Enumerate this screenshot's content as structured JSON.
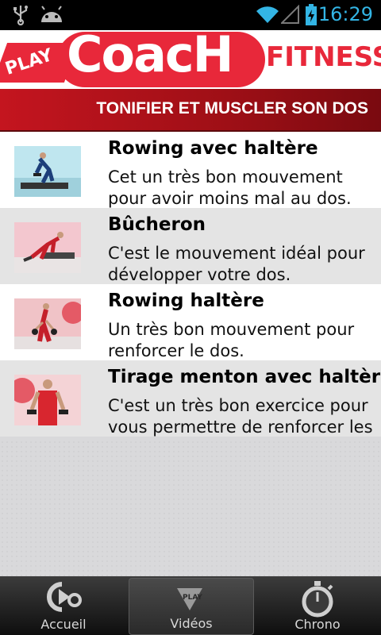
{
  "status_bar": {
    "time": "16:29",
    "icons": [
      "usb-icon",
      "android-icon",
      "wifi-icon",
      "signal-icon",
      "battery-charging-icon"
    ],
    "accent_color": "#33b5e5"
  },
  "header": {
    "logo_play": "PLAY",
    "logo_coach": "CoacH",
    "logo_fitness": "FITNESS",
    "brand_color": "#e8283a"
  },
  "title_bar": {
    "title": "TONIFIER ET MUSCLER SON DOS"
  },
  "videos": [
    {
      "title": "Rowing avec haltère",
      "description_line1": "Cet un très bon mouvement",
      "description_line2": "pour avoir moins mal au dos."
    },
    {
      "title": "Bûcheron",
      "description_line1": "C'est le mouvement idéal pour",
      "description_line2": "développer votre dos."
    },
    {
      "title": "Rowing haltère",
      "description_line1": "Un très bon mouvement pour",
      "description_line2": "renforcer le dos."
    },
    {
      "title": "Tirage menton avec haltères",
      "description_line1": "C'est un très bon exercice pour",
      "description_line2": "vous permettre de renforcer les"
    }
  ],
  "tabs": [
    {
      "label": "Accueil",
      "icon": "home-play-icon"
    },
    {
      "label": "Vidéos",
      "icon": "play-video-icon",
      "active": true
    },
    {
      "label": "Chrono",
      "icon": "stopwatch-icon"
    }
  ]
}
